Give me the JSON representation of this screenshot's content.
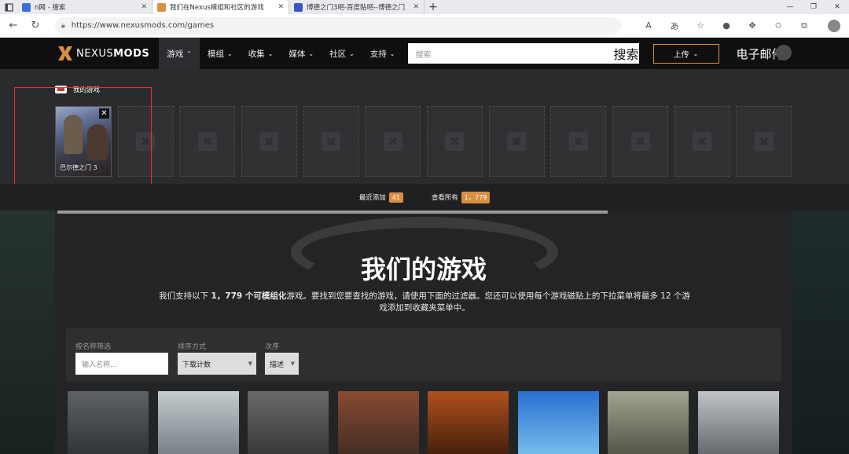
{
  "browser": {
    "tabs": [
      {
        "title": "n网 - 搜索",
        "favicon_color": "#3b6fd8",
        "active": false
      },
      {
        "title": "我们在Nexus模组和社区的游戏",
        "favicon_color": "#d98f40",
        "active": true
      },
      {
        "title": "博德之门3吧-百度贴吧--博德之门",
        "favicon_color": "#3b55c8",
        "active": false
      }
    ],
    "new_tab": "+",
    "url": "https://www.nexusmods.com/games",
    "toolbar_icons": [
      "read-aloud-icon",
      "translate-icon",
      "favorite-add-icon",
      "extension-icon",
      "puzzle-icon",
      "collections-icon",
      "profile-icon"
    ]
  },
  "header": {
    "logo_nexus": "NEXUS",
    "logo_mods": "MODS",
    "nav": [
      {
        "label": "游戏",
        "active": true
      },
      {
        "label": "模组",
        "active": false
      },
      {
        "label": "收集",
        "active": false
      },
      {
        "label": "媒体",
        "active": false
      },
      {
        "label": "社区",
        "active": false
      },
      {
        "label": "支持",
        "active": false
      }
    ],
    "search_placeholder": "搜索",
    "search_label": "搜索",
    "upload_label": "上传",
    "mail_label": "电子邮件",
    "accent": "#d98f40"
  },
  "my_games": {
    "title": "我的游戏",
    "favorites": [
      {
        "name": "巴尔德之门 3"
      }
    ],
    "empty_slots": 11
  },
  "counts": {
    "recent_label": "最近添加",
    "recent_count": "41",
    "all_label": "查看所有",
    "all_count": "1，779"
  },
  "hero": {
    "title": "我们的游戏",
    "desc_prefix": "我们支持以下 ",
    "desc_bold": "1，779 个可模组化",
    "desc_suffix": "游戏。要找到您要查找的游戏，请使用下面的过滤器。您还可以使用每个游戏磁贴上的下拉菜单将最多 12 个游戏添加到收藏夹菜单中。"
  },
  "filters": {
    "name_label": "按名称筛选",
    "name_placeholder": "输入名称...",
    "sort_label": "排序方式",
    "sort_value": "下载计数",
    "order_label": "次序",
    "order_value": "描述"
  },
  "tiles": [
    {
      "game": "skyrim-special-edition",
      "color": "#4a4f52"
    },
    {
      "game": "skyrim",
      "color": "#8f9aa0"
    },
    {
      "game": "fallout-4",
      "color": "#555"
    },
    {
      "game": "fallout-new-vegas",
      "color": "#6b3a2a"
    },
    {
      "game": "oblivion",
      "color": "#8a3a1a"
    },
    {
      "game": "stardew-valley",
      "color": "#4aa0e0"
    },
    {
      "game": "fallout-3",
      "color": "#6d7060"
    },
    {
      "game": "witcher-3",
      "color": "#9aa0a8"
    }
  ]
}
